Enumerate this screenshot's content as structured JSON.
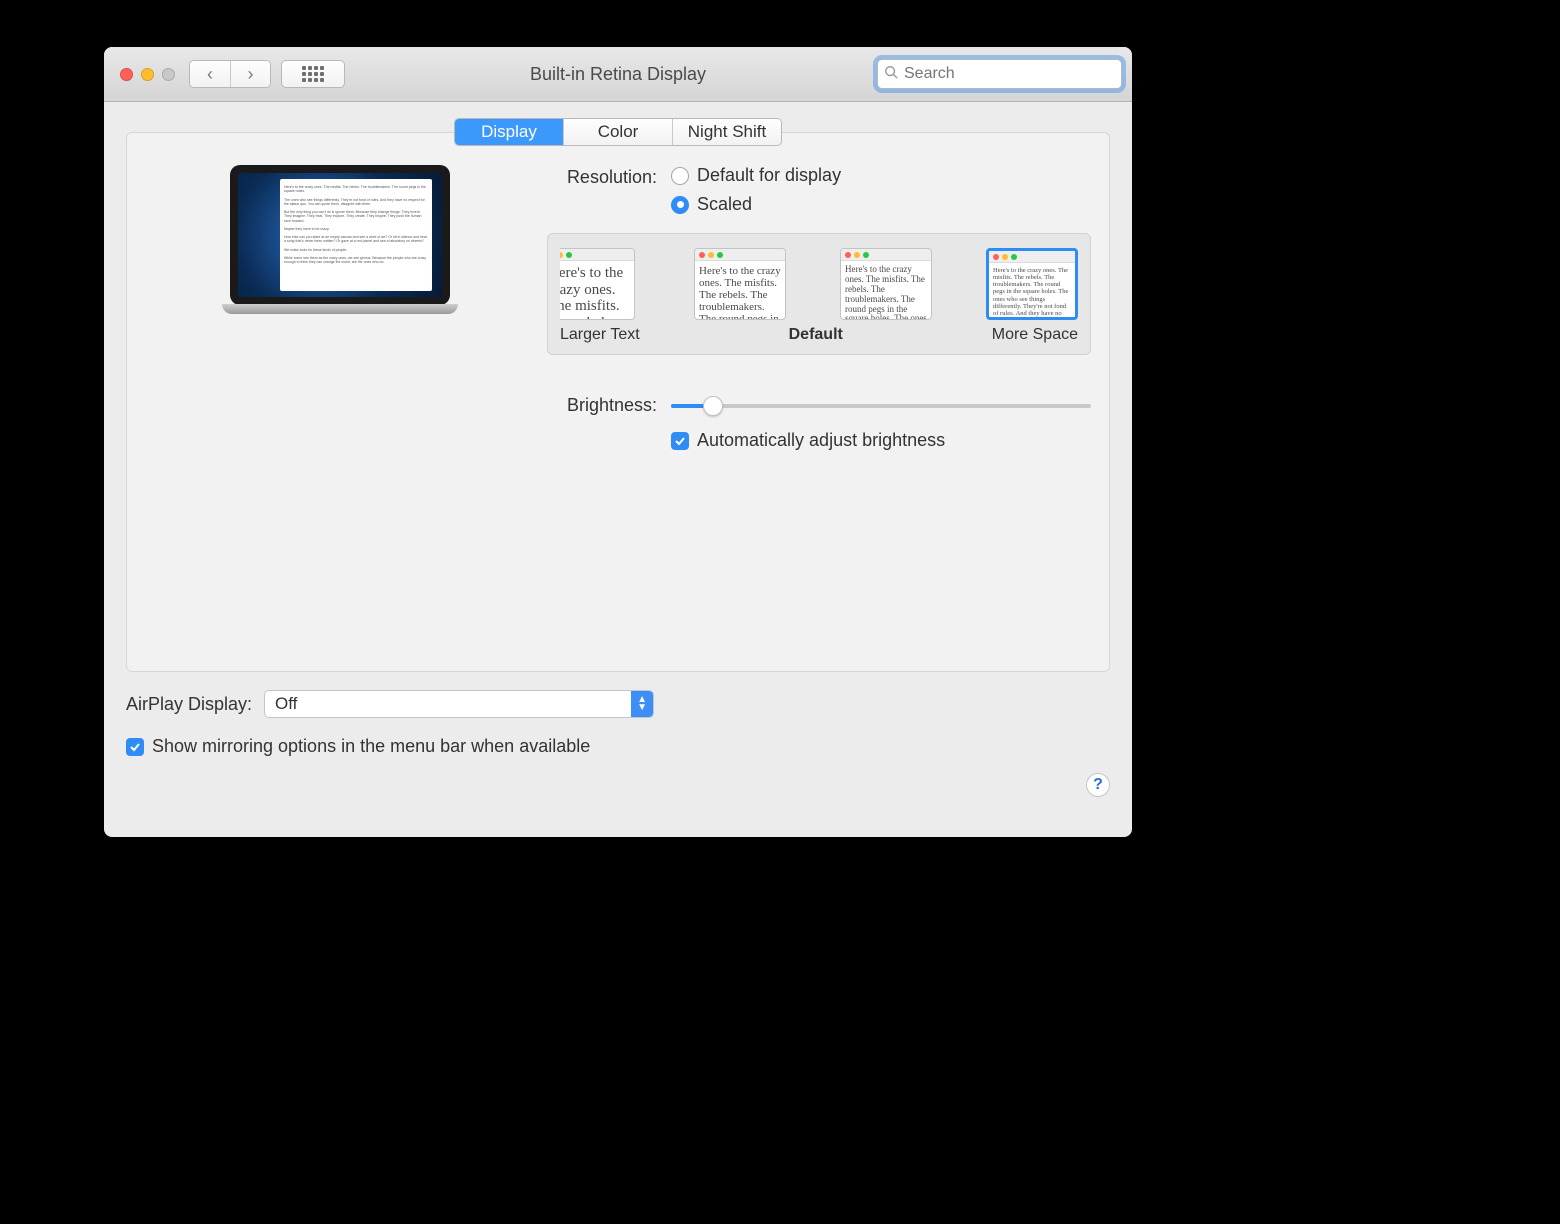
{
  "window": {
    "title": "Built-in Retina Display"
  },
  "search": {
    "placeholder": "Search"
  },
  "tabs": [
    "Display",
    "Color",
    "Night Shift"
  ],
  "tab_active_index": 0,
  "resolution": {
    "label": "Resolution:",
    "options": [
      "Default for display",
      "Scaled"
    ],
    "selected_index": 1
  },
  "scaled": {
    "labels": {
      "left": "Larger Text",
      "mid": "Default",
      "right": "More Space"
    },
    "selected_index": 3,
    "preview_text": "Here's to the crazy ones. The misfits. The rebels. The troublemakers. The round pegs in the square holes. The ones who see things differently. They're not fond of rules. And they have no respect for the status quo. You can quote them, disagree with them, glorify or vilify them. About the only thing you can't do is ignore them. Because they change things."
  },
  "brightness": {
    "label": "Brightness:",
    "value_percent": 10,
    "auto_label": "Automatically adjust brightness",
    "auto_checked": true
  },
  "airplay": {
    "label": "AirPlay Display:",
    "value": "Off"
  },
  "mirroring": {
    "label": "Show mirroring options in the menu bar when available",
    "checked": true
  },
  "help": "?"
}
